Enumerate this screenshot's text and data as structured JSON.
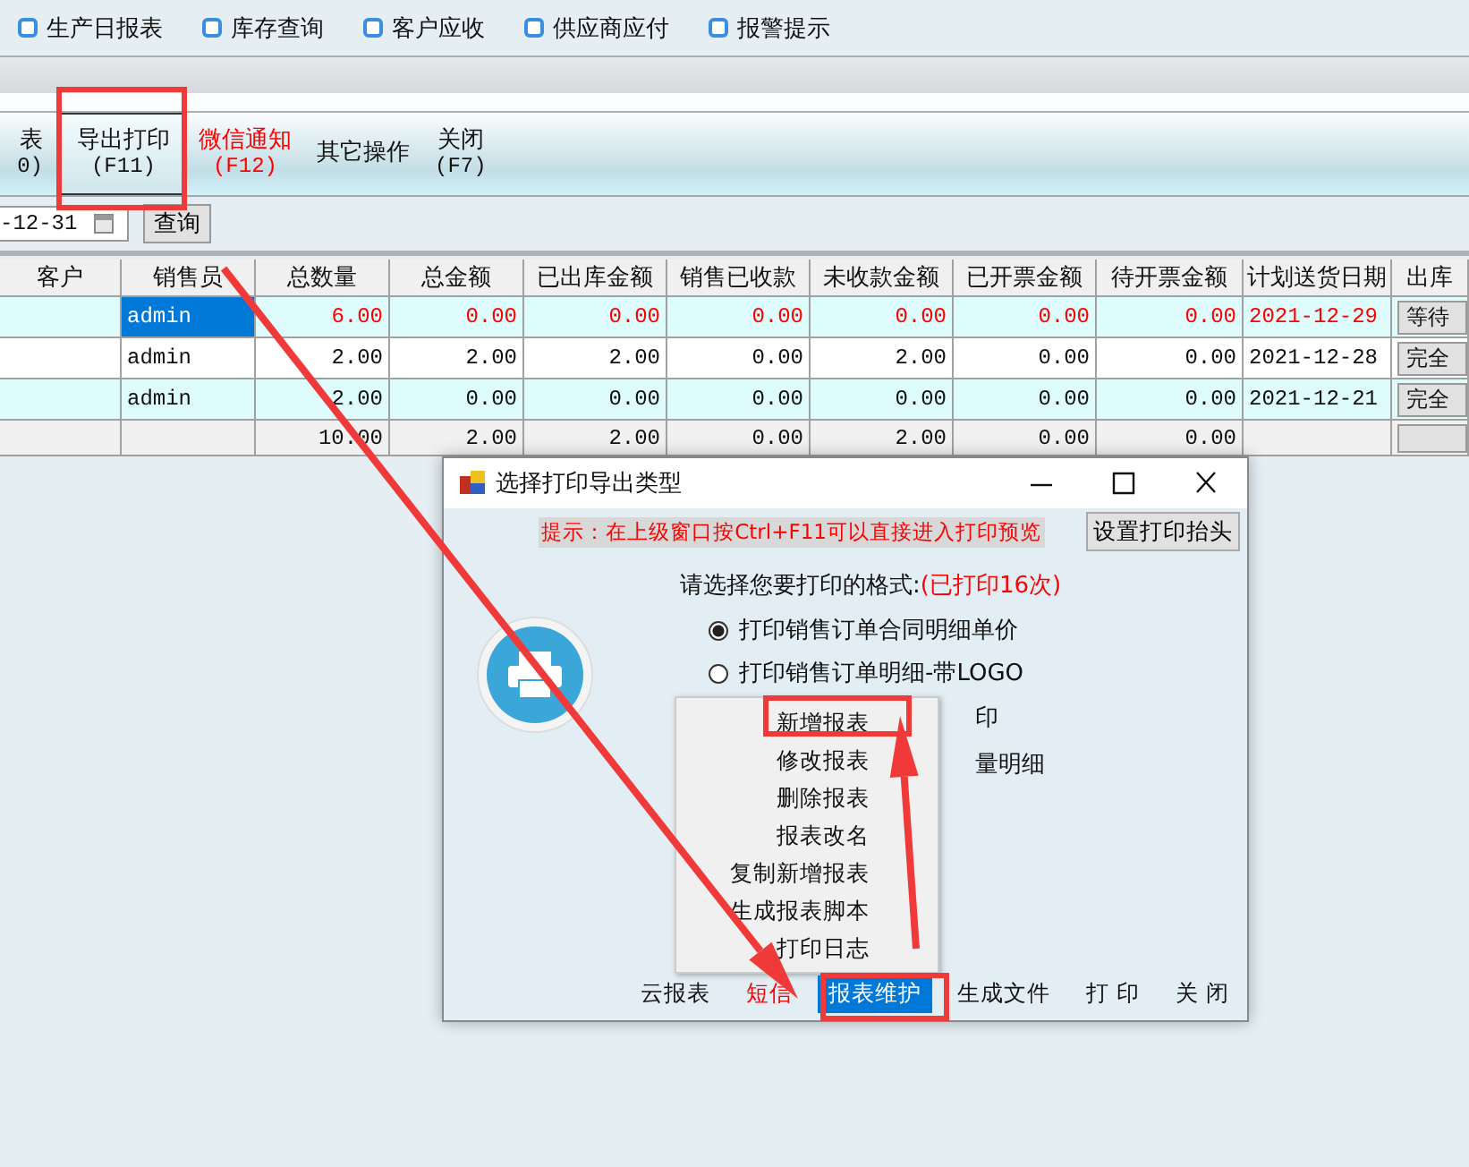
{
  "quick_links": [
    {
      "label": "生产日报表",
      "checked": false
    },
    {
      "label": "库存查询",
      "checked": false
    },
    {
      "label": "客户应收",
      "checked": false
    },
    {
      "label": "供应商应付",
      "checked": false
    },
    {
      "label": "报警提示",
      "checked": false
    }
  ],
  "tabs": [
    {
      "label": "表",
      "shortcut": "0)",
      "selected": false,
      "alert": false
    },
    {
      "label": "导出打印",
      "shortcut": "(F11)",
      "selected": true,
      "alert": false
    },
    {
      "label": "微信通知",
      "shortcut": "(F12)",
      "selected": false,
      "alert": true
    },
    {
      "label": "其它操作",
      "selected": false,
      "alert": false
    },
    {
      "label": "关闭",
      "shortcut": "(F7)",
      "selected": false,
      "alert": false
    }
  ],
  "filter": {
    "date_value": "-12-31",
    "button": "查询"
  },
  "table": {
    "columns": [
      "客户",
      "销售员",
      "总数量",
      "总金额",
      "已出库金额",
      "销售已收款",
      "未收款金额",
      "已开票金额",
      "待开票金额",
      "计划送货日期",
      "出库"
    ],
    "rows": [
      {
        "overdue": true,
        "selected": true,
        "cells": [
          "",
          "admin",
          "6.00",
          "0.00",
          "0.00",
          "0.00",
          "0.00",
          "0.00",
          "0.00",
          "2021-12-29"
        ],
        "status": "等待"
      },
      {
        "overdue": false,
        "selected": false,
        "cells": [
          "",
          "admin",
          "2.00",
          "2.00",
          "2.00",
          "0.00",
          "2.00",
          "0.00",
          "0.00",
          "2021-12-28"
        ],
        "status": "完全"
      },
      {
        "overdue": false,
        "selected": false,
        "cells": [
          "",
          "admin",
          "2.00",
          "0.00",
          "0.00",
          "0.00",
          "0.00",
          "0.00",
          "0.00",
          "2021-12-21"
        ],
        "status": "完全"
      }
    ],
    "totals": [
      "10.00",
      "2.00",
      "2.00",
      "0.00",
      "2.00",
      "0.00",
      "0.00"
    ]
  },
  "dialog": {
    "title": "选择打印导出类型",
    "hint": "提示：在上级窗口按Ctrl+F11可以直接进入打印预览",
    "header_button": "设置打印抬头",
    "prompt": "请选择您要打印的格式:",
    "print_count": "(已打印16次)",
    "options": [
      {
        "label": "打印销售订单合同明细单价",
        "selected": true,
        "kind": "full"
      },
      {
        "label": "打印销售订单明细-带LOGO",
        "selected": false,
        "kind": "full"
      },
      {
        "label": "印",
        "kind": "covered"
      },
      {
        "label": "量明细",
        "kind": "covered"
      }
    ],
    "menu": [
      "新增报表",
      "修改报表",
      "删除报表",
      "报表改名",
      "复制新增报表",
      "生成报表脚本",
      "打印日志"
    ],
    "buttons": [
      {
        "label": "云报表",
        "selected": false,
        "alert": false
      },
      {
        "label": "短信",
        "selected": false,
        "alert": true
      },
      {
        "label": "报表维护",
        "selected": true,
        "alert": false
      },
      {
        "label": "生成文件",
        "selected": false,
        "alert": false
      },
      {
        "label": "打 印",
        "selected": false,
        "alert": false
      },
      {
        "label": "关 闭",
        "selected": false,
        "alert": false
      }
    ]
  },
  "annotations": [
    {
      "kind": "frame"
    },
    {
      "kind": "frame"
    },
    {
      "kind": "frame"
    },
    {
      "kind": "arrow"
    },
    {
      "kind": "arrow"
    }
  ]
}
